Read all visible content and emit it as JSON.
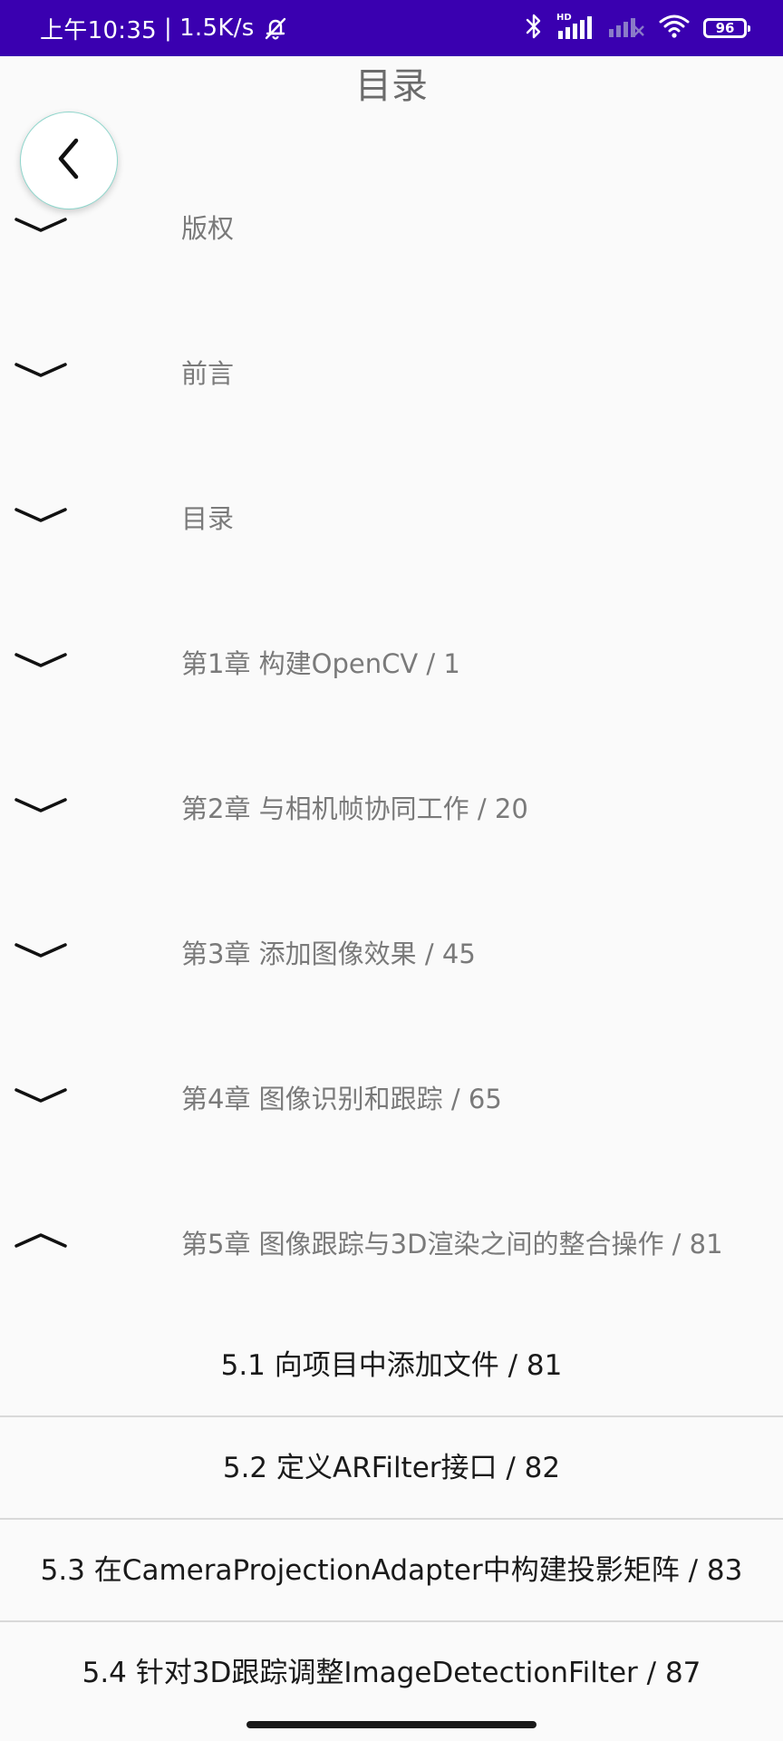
{
  "status_bar": {
    "time": "上午10:35",
    "separator": "|",
    "speed": "1.5K/s",
    "hd_label": "HD",
    "battery": "96",
    "background_color": "#3a00b0"
  },
  "header": {
    "title": "目录",
    "back_icon": "chevron-left-icon"
  },
  "chapters": [
    {
      "label": "版权",
      "expanded": false
    },
    {
      "label": "前言",
      "expanded": false
    },
    {
      "label": "目录",
      "expanded": false
    },
    {
      "label": "第1章  构建OpenCV / 1",
      "expanded": false
    },
    {
      "label": "第2章  与相机帧协同工作 / 20",
      "expanded": false
    },
    {
      "label": "第3章  添加图像效果 / 45",
      "expanded": false
    },
    {
      "label": "第4章  图像识别和跟踪 / 65",
      "expanded": false
    },
    {
      "label": "第5章  图像跟踪与3D渲染之间的整合操作 / 81",
      "expanded": true
    }
  ],
  "sections": [
    {
      "label": "5.1 向项目中添加文件 / 81"
    },
    {
      "label": "5.2 定义ARFilter接口 / 82"
    },
    {
      "label": "5.3 在CameraProjectionAdapter中构建投影矩阵 / 83"
    },
    {
      "label": "5.4 针对3D跟踪调整ImageDetectionFilter / 87"
    }
  ]
}
